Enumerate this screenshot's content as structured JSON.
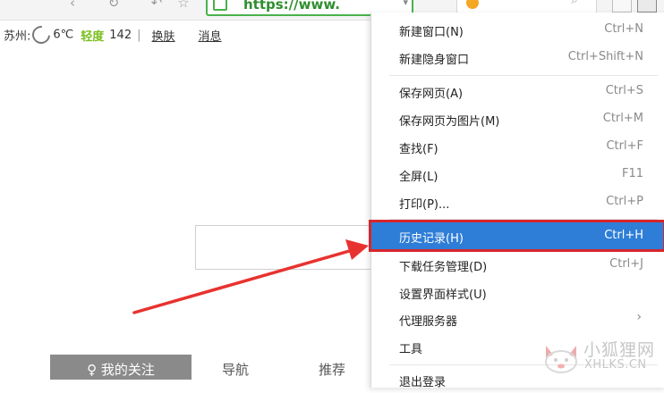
{
  "toolbar": {
    "address_url": "https://www.",
    "address_dropdown": "▾"
  },
  "infobar": {
    "city": "苏州:",
    "temperature": "6℃",
    "air_quality": "轻度",
    "aqi": "142",
    "separator": "|",
    "link_skin": "换肤",
    "link_messages": "消息"
  },
  "tabs": {
    "my_follow": "♀ 我的关注",
    "navigation": "导航",
    "recommend": "推荐"
  },
  "menu": {
    "items": [
      {
        "label": "新建窗口(N)",
        "shortcut": "Ctrl+N"
      },
      {
        "label": "新建隐身窗口",
        "shortcut": "Ctrl+Shift+N"
      },
      {
        "label": "保存网页(A)",
        "shortcut": "Ctrl+S"
      },
      {
        "label": "保存网页为图片(M)",
        "shortcut": "Ctrl+M"
      },
      {
        "label": "查找(F)",
        "shortcut": "Ctrl+F"
      },
      {
        "label": "全屏(L)",
        "shortcut": "F11"
      },
      {
        "label": "打印(P)...",
        "shortcut": "Ctrl+P"
      },
      {
        "label": "历史记录(H)",
        "shortcut": "Ctrl+H"
      },
      {
        "label": "下载任务管理(D)",
        "shortcut": "Ctrl+J"
      },
      {
        "label": "设置界面样式(U)",
        "shortcut": ""
      },
      {
        "label": "代理服务器",
        "shortcut": "",
        "submenu_arrow": "›"
      },
      {
        "label": "工具",
        "shortcut": ""
      },
      {
        "label": "退出登录",
        "shortcut": ""
      }
    ],
    "highlight_color": "#2e7ed8",
    "highlight_border_color": "#d6262b"
  },
  "watermark": {
    "chinese": "小狐狸网",
    "domain": "XHLKS.CN"
  },
  "colors": {
    "arrow": "#e8322f",
    "address_border": "#49b24a",
    "air_quality": "#7bbf1f"
  }
}
